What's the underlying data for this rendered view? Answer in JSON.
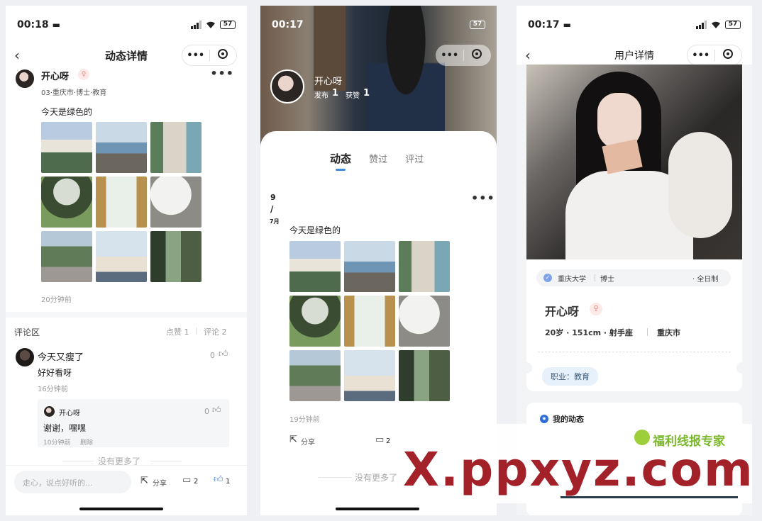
{
  "detail": {
    "status_time": "00:18",
    "battery": "57",
    "title": "动态详情",
    "user_name": "开心呀",
    "user_meta": "03·重庆市·博士·教育",
    "post_text": "今天是绿色的",
    "post_time": "20分钟前",
    "comments_header": "评论区",
    "likes_label": "点赞 1",
    "comments_label": "评论 2",
    "comment": {
      "name": "今天又瘦了",
      "likes": "0",
      "text": "好好看呀",
      "time": "16分钟前"
    },
    "reply": {
      "name": "开心呀",
      "likes": "0",
      "text": "谢谢，嘿嘿",
      "time": "10分钟前",
      "delete": "删除"
    },
    "no_more": "没有更多了",
    "input_placeholder": "走心，说点好听的...",
    "share": "分享",
    "comment_count": "2",
    "like_count": "1"
  },
  "profile": {
    "status_time": "00:17",
    "battery": "57",
    "name": "开心呀",
    "posts_label": "发布",
    "posts": "1",
    "likes_label": "获赞",
    "likes": "1",
    "tabs": [
      "动态",
      "赞过",
      "评过"
    ],
    "date_day": "9",
    "date_slash": "/",
    "date_month": "7月",
    "post_text": "今天是绿色的",
    "post_time": "19分钟前",
    "share": "分享",
    "comment_count": "2",
    "no_more": "没有更多了"
  },
  "user": {
    "status_time": "00:17",
    "battery": "57",
    "title": "用户详情",
    "school": "重庆大学",
    "degree": "博士",
    "study_mode": "· 全日制",
    "name": "开心呀",
    "info": "20岁 · 151cm · 射手座",
    "city": "重庆市",
    "job": "职业：教育",
    "my_posts": "我的动态"
  },
  "watermark": {
    "brand": "福利线报专家",
    "domain": "X.ppxyz.com"
  }
}
